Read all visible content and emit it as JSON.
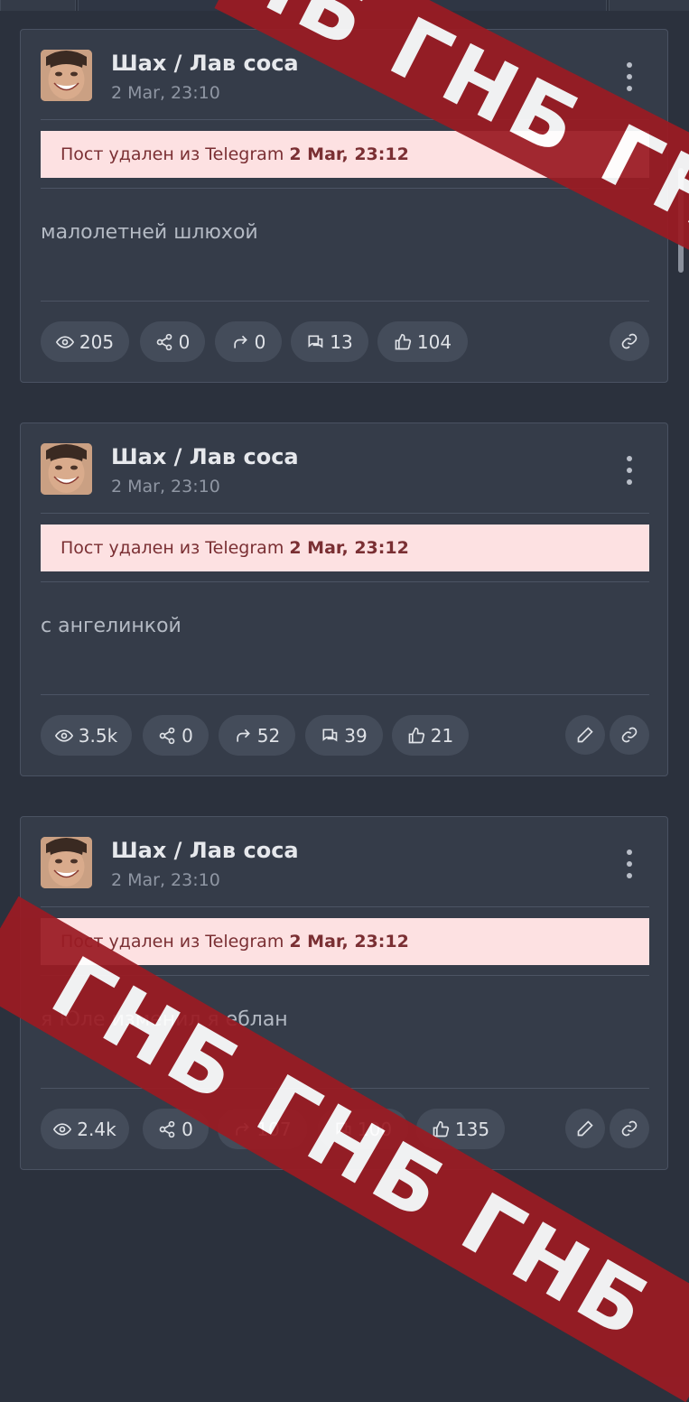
{
  "watermark": {
    "top_text": "НБ ГНБ ГНБ",
    "bottom_text": "ГНБ ГНБ ГНБ"
  },
  "posts": [
    {
      "author": "Шах / Лав соса",
      "date": "2 Mar, 23:10",
      "deleted_prefix": "Пост удален из Telegram",
      "deleted_date": "2 Mar, 23:12",
      "text": "малолетней шлюхой",
      "stats": {
        "views": "205",
        "shares": "0",
        "forwards": "0",
        "comments": "13",
        "likes": "104"
      }
    },
    {
      "author": "Шах / Лав соса",
      "date": "2 Mar, 23:10",
      "deleted_prefix": "Пост удален из Telegram",
      "deleted_date": "2 Mar, 23:12",
      "text": "с ангелинкой",
      "stats": {
        "views": "3.5k",
        "shares": "0",
        "forwards": "52",
        "comments": "39",
        "likes": "21"
      }
    },
    {
      "author": "Шах / Лав соса",
      "date": "2 Mar, 23:10",
      "deleted_prefix": "Пост удален из Telegram",
      "deleted_date": "2 Mar, 23:12",
      "text": "я Юле изменил я еблан",
      "stats": {
        "views": "2.4k",
        "shares": "0",
        "forwards": "107",
        "comments": "100",
        "likes": "135"
      }
    }
  ]
}
